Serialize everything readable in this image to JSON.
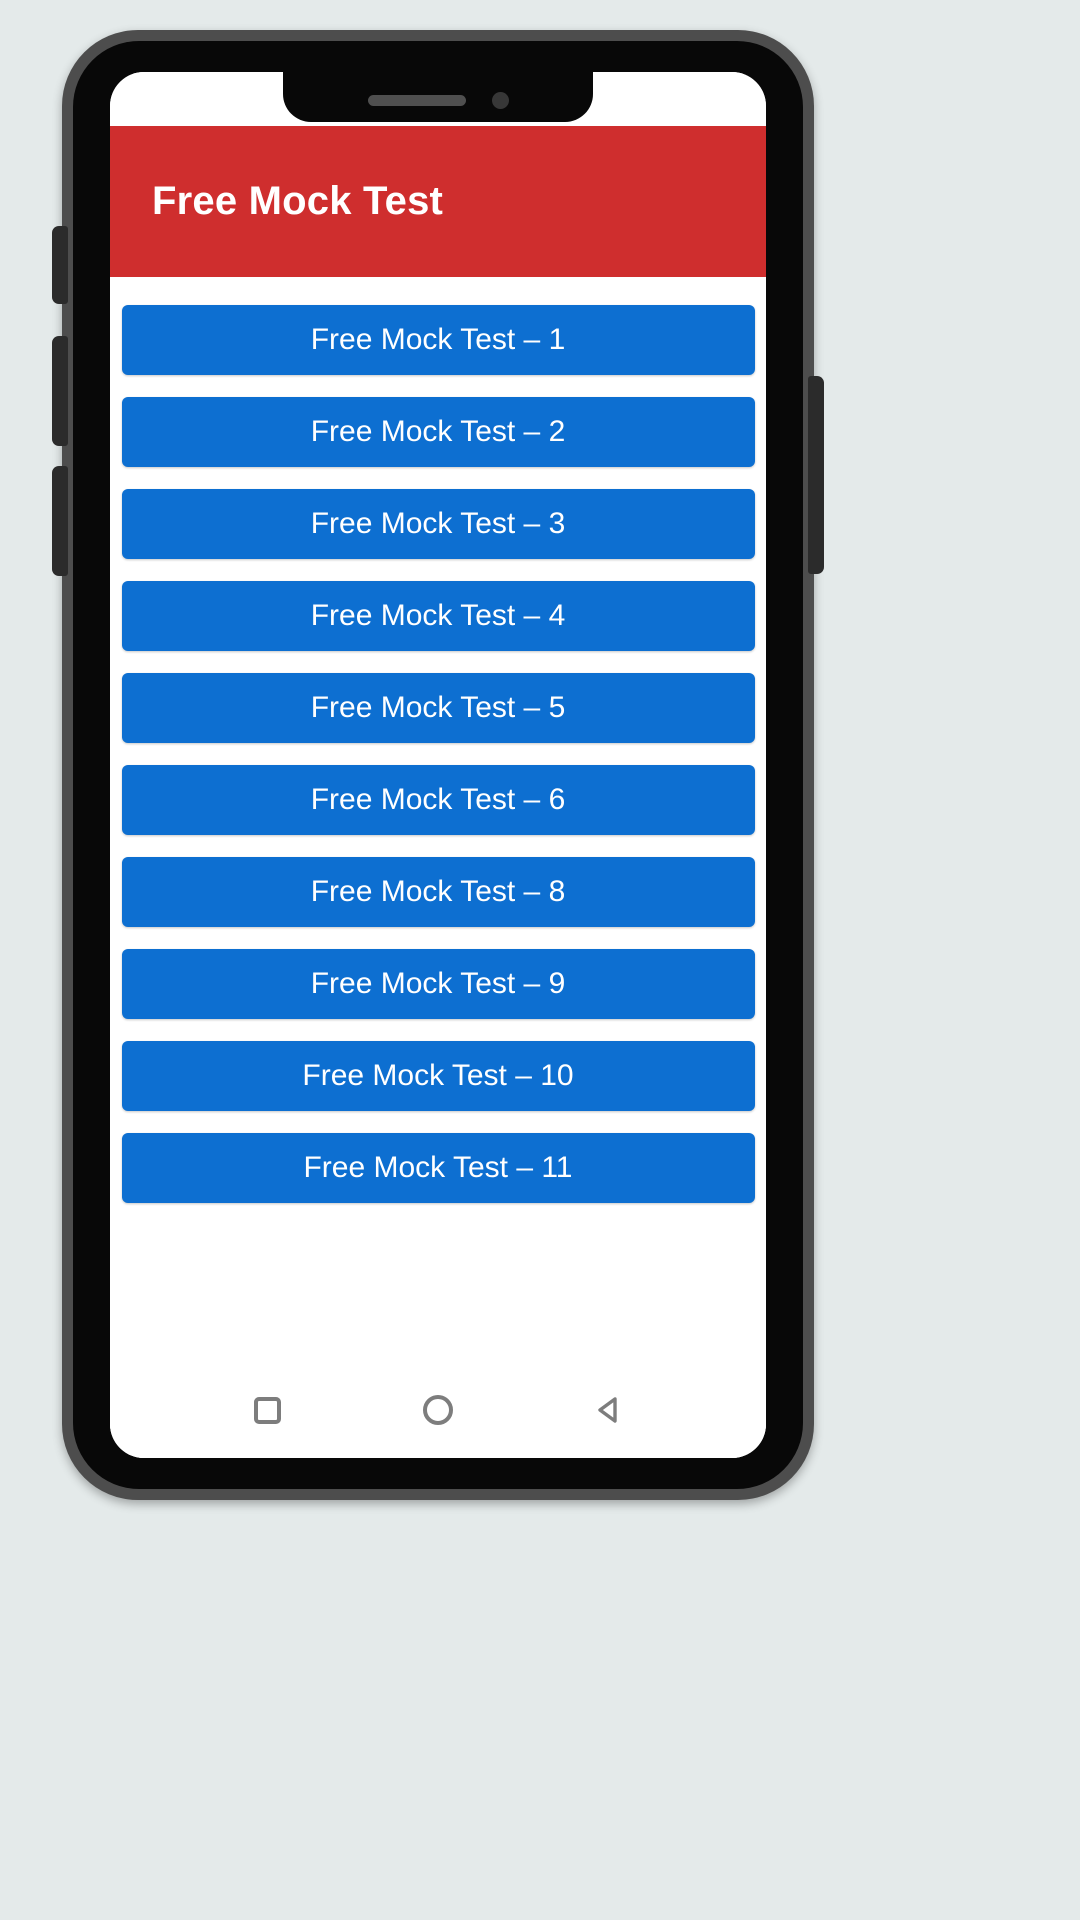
{
  "device": {
    "notch": {
      "speaker_icon": "earpiece-speaker-icon",
      "camera_icon": "front-camera-icon"
    },
    "side_buttons": [
      {
        "name": "volume-up-button"
      },
      {
        "name": "volume-down-button"
      },
      {
        "name": "mute-switch-button"
      },
      {
        "name": "power-button"
      }
    ],
    "frame_color": "#4d4d4d",
    "bezel_color": "#080808",
    "page_background": "#e4eaea"
  },
  "app": {
    "header": {
      "title": "Free Mock Test",
      "background_color": "#cf2e2e",
      "text_color": "#ffffff"
    },
    "button_color": "#0d6fd1",
    "button_text_color": "#ffffff",
    "mock_tests": [
      {
        "label": "Free Mock Test – 1"
      },
      {
        "label": "Free Mock Test – 2"
      },
      {
        "label": "Free Mock Test – 3"
      },
      {
        "label": "Free Mock Test – 4"
      },
      {
        "label": "Free Mock Test – 5"
      },
      {
        "label": "Free Mock Test – 6"
      },
      {
        "label": "Free Mock Test – 8"
      },
      {
        "label": "Free Mock Test – 9"
      },
      {
        "label": "Free Mock Test – 10"
      },
      {
        "label": "Free Mock Test – 11"
      }
    ]
  },
  "navigation_bar": {
    "recents_icon": "recents-square-icon",
    "home_icon": "home-circle-icon",
    "back_icon": "back-triangle-icon",
    "icon_color": "#7d7d7d"
  }
}
